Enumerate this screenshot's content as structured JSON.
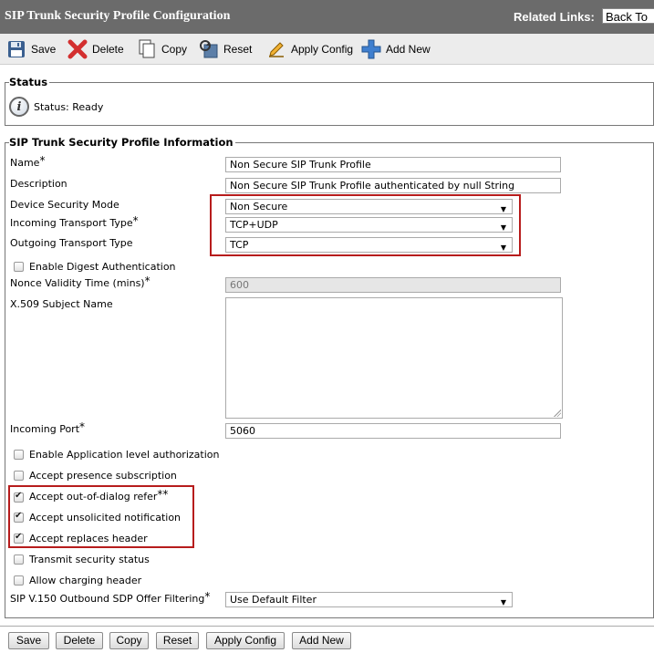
{
  "header": {
    "title": "SIP Trunk Security Profile Configuration",
    "related_links_label": "Related Links:",
    "related_links_value": "Back To"
  },
  "toolbar": {
    "save": "Save",
    "delete": "Delete",
    "copy": "Copy",
    "reset": "Reset",
    "apply_config": "Apply Config",
    "add_new": "Add New"
  },
  "status": {
    "legend": "Status",
    "text": "Status: Ready"
  },
  "profile": {
    "legend": "SIP Trunk Security Profile Information",
    "name_label": "Name",
    "name_value": "Non Secure SIP Trunk Profile",
    "description_label": "Description",
    "description_value": "Non Secure SIP Trunk Profile authenticated by null String",
    "device_security_mode_label": "Device Security Mode",
    "device_security_mode_value": "Non Secure",
    "incoming_transport_label": "Incoming Transport Type",
    "incoming_transport_value": "TCP+UDP",
    "outgoing_transport_label": "Outgoing Transport Type",
    "outgoing_transport_value": "TCP",
    "enable_digest_label": "Enable Digest Authentication",
    "nonce_label": "Nonce Validity Time (mins)",
    "nonce_value": "600",
    "x509_label": "X.509 Subject Name",
    "incoming_port_label": "Incoming Port",
    "incoming_port_value": "5060",
    "enable_app_auth_label": "Enable Application level authorization",
    "accept_presence_label": "Accept presence subscription",
    "accept_ood_refer_label": "Accept out-of-dialog refer",
    "accept_unsolicited_label": "Accept unsolicited notification",
    "accept_replaces_label": "Accept replaces header",
    "transmit_security_label": "Transmit security status",
    "allow_charging_label": "Allow charging header",
    "sdp_filter_label": "SIP V.150 Outbound SDP Offer Filtering",
    "sdp_filter_value": "Use Default Filter",
    "required_mark": "*",
    "double_mark": "**"
  },
  "checkboxes": {
    "enable_digest": false,
    "enable_app_auth": false,
    "accept_presence": false,
    "accept_ood_refer": true,
    "accept_unsolicited": true,
    "accept_replaces": true,
    "transmit_security": false,
    "allow_charging": false
  },
  "bottom_buttons": {
    "save": "Save",
    "delete": "Delete",
    "copy": "Copy",
    "reset": "Reset",
    "apply_config": "Apply Config",
    "add_new": "Add New"
  },
  "colors": {
    "titlebar_bg": "#6b6b6b",
    "toolbar_bg": "#ececec",
    "highlight_box": "#b71c1c",
    "delete_icon": "#d32f2f",
    "add_icon": "#3f7fcf"
  }
}
